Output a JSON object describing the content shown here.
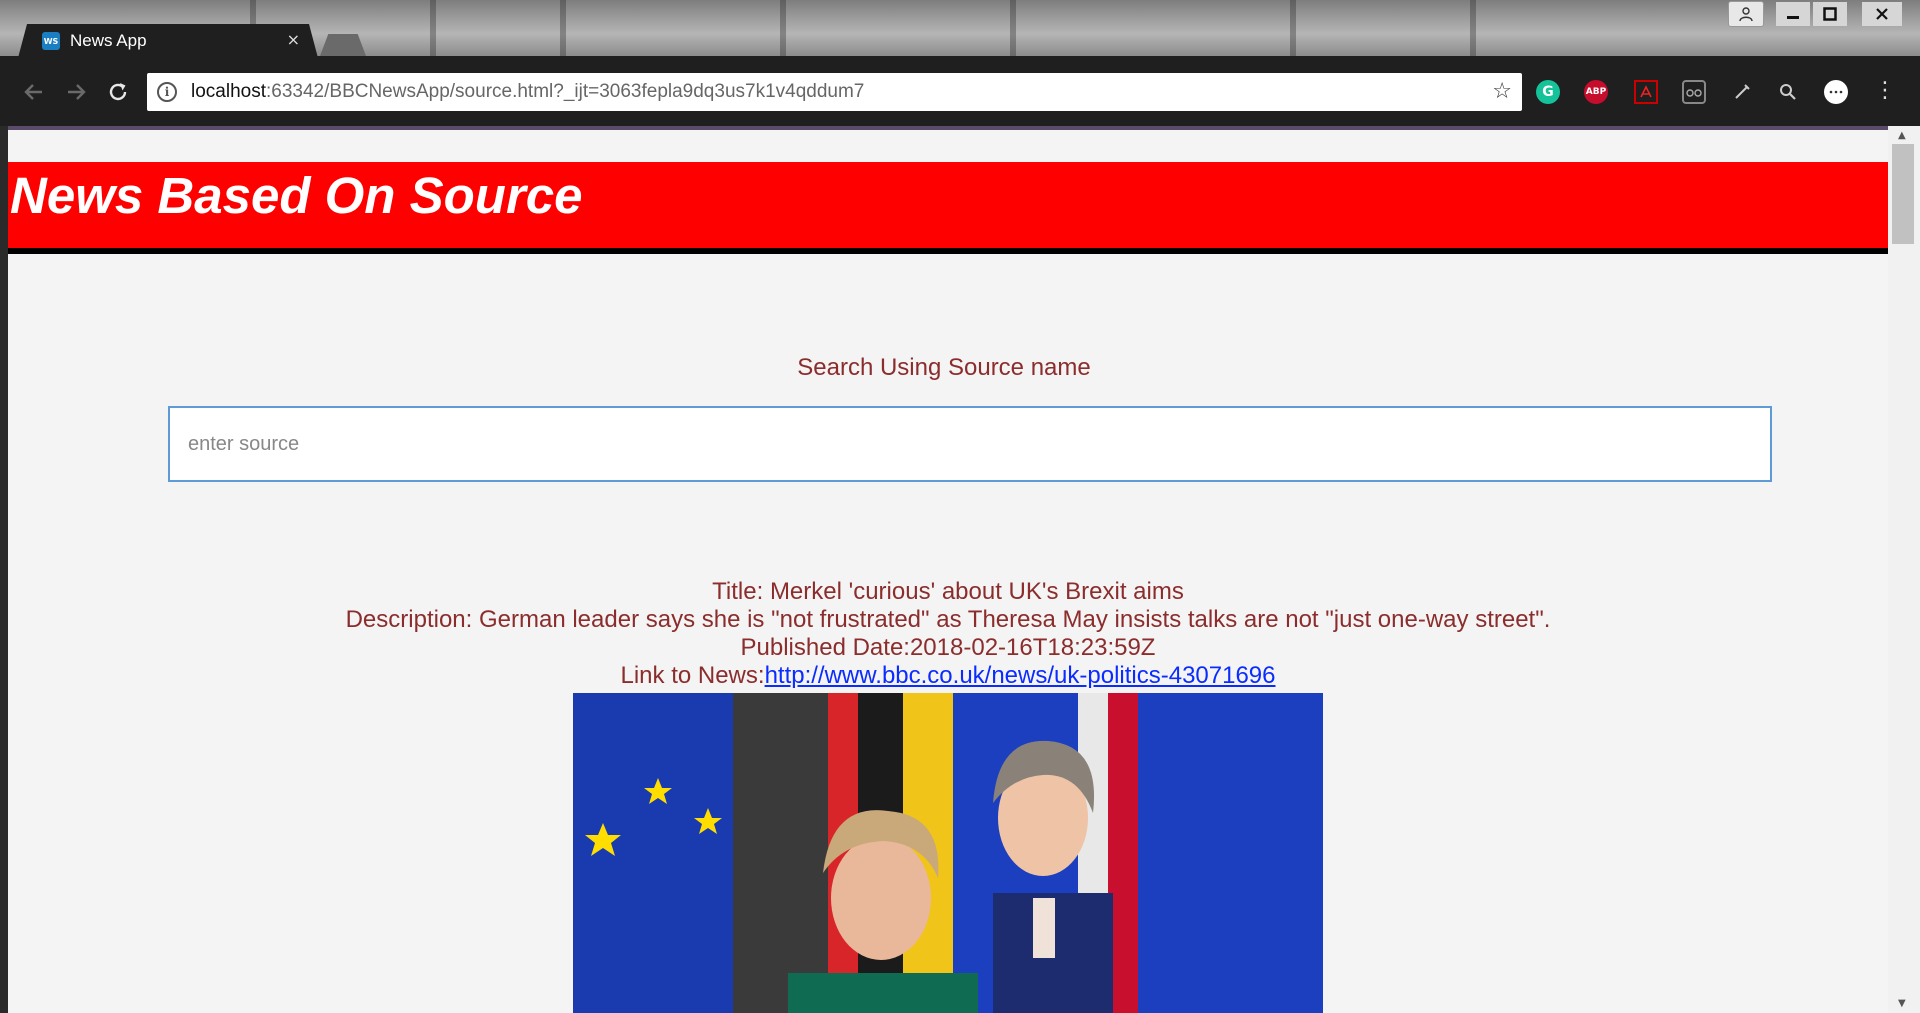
{
  "browser": {
    "tab_title": "News App",
    "tab_favicon_text": "WS",
    "tab_close": "×",
    "address": {
      "host": "localhost",
      "path": ":63342/BBCNewsApp/source.html?_ijt=3063fepla9dq3us7k1v4qddum7"
    },
    "extensions": [
      "grammarly-icon",
      "adblock-plus-icon",
      "pdf-icon",
      "glasses-icon",
      "pen-icon",
      "search-icon",
      "dots-icon"
    ],
    "ext_labels": {
      "grammarly": "G",
      "abp": "ABP"
    },
    "colors": {
      "tab_bg": "#1f1f1f",
      "toolbar_bg": "#1f1f1f"
    }
  },
  "page": {
    "header_title": "News Based On Source",
    "search_label": "Search Using Source name",
    "search_placeholder": "enter source",
    "article": {
      "title": "Title: Merkel 'curious' about UK's Brexit aims",
      "description": "Description: German leader says she is \"not frustrated\" as Theresa May insists talks are not \"just one-way street\".",
      "published": "Published Date:2018-02-16T18:23:59Z",
      "link_prefix": "Link to News:",
      "link_text": "http://www.bbc.co.uk/news/uk-politics-43071696"
    },
    "colors": {
      "header_bg": "#ff0000",
      "header_text": "#ffffff",
      "body_text": "#8b2d2d",
      "link": "#0a2cff",
      "page_bg": "#f4f4f4",
      "input_border": "#5e9ad6"
    }
  }
}
